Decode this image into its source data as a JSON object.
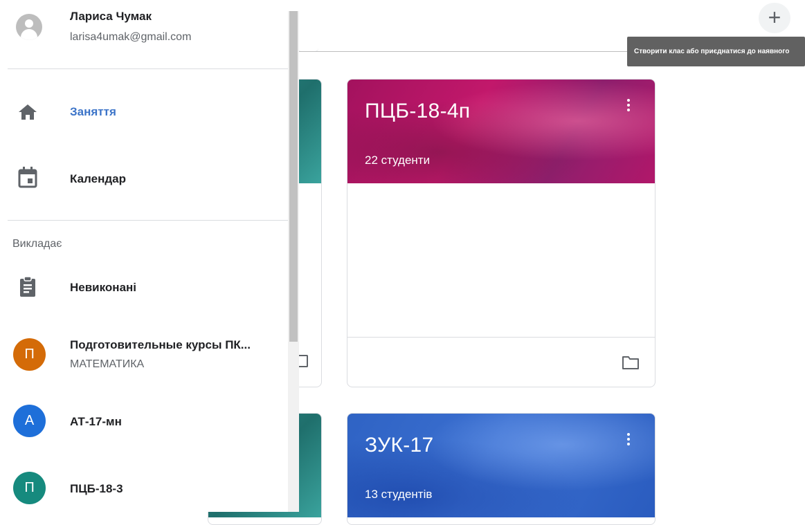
{
  "user": {
    "name": "Лариса Чумак",
    "email": "larisa4umak@gmail.com"
  },
  "nav": {
    "items": [
      {
        "label": "Заняття",
        "icon": "home-icon",
        "active": true
      },
      {
        "label": "Календар",
        "icon": "calendar-icon",
        "active": false
      }
    ]
  },
  "teaching": {
    "section_label": "Викладає",
    "todo_label": "Невиконані",
    "classes": [
      {
        "letter": "П",
        "title": "Подготовительные курсы ПК...",
        "subtitle": "МАТЕМАТИКА",
        "color": "#d46b08"
      },
      {
        "letter": "А",
        "title": "АТ-17-мн",
        "subtitle": "",
        "color": "#1e6fd9"
      },
      {
        "letter": "П",
        "title": "ПЦБ-18-3",
        "subtitle": "",
        "color": "#168a7e"
      }
    ]
  },
  "header": {
    "add_button": "+",
    "tooltip": "Створити клас або приєднатися до наявного"
  },
  "cards": [
    {
      "title": "ПЦБ-18-4п",
      "students": "22 студенти",
      "color": "#b0166a"
    },
    {
      "title": "ЗУК-17",
      "students": "13 студентів",
      "color": "#3166c9"
    }
  ]
}
